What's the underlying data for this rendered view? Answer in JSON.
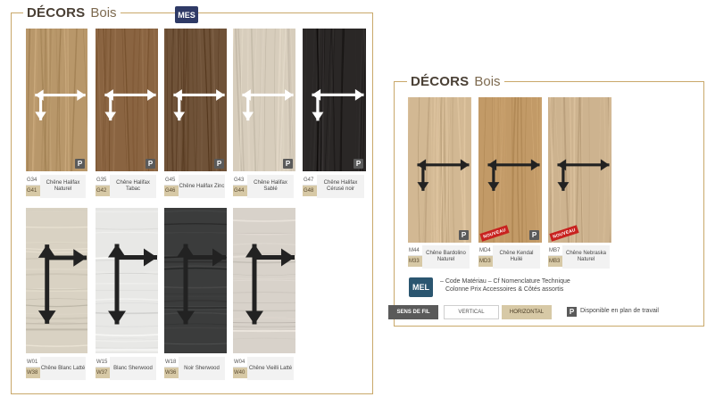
{
  "left_panel": {
    "title_main": "DÉCORS",
    "title_sub": "Bois",
    "badge": "MES",
    "swatches": [
      {
        "code_top": "G34",
        "code_bottom": "G41",
        "name": "Chêne Halifax Naturel",
        "p_badge": "P",
        "color": "#b8976a"
      },
      {
        "code_top": "G35",
        "code_bottom": "G42",
        "name": "Chêne Halifax Tabac",
        "p_badge": "P",
        "color": "#8a6441"
      },
      {
        "code_top": "G45",
        "code_bottom": "G46",
        "name": "Chêne Halifax Zinc",
        "p_badge": "P",
        "color": "#6f5238"
      },
      {
        "code_top": "G43",
        "code_bottom": "G44",
        "name": "Chêne Halifax Sablé",
        "p_badge": "P",
        "color": "#d7cdbc"
      },
      {
        "code_top": "G47",
        "code_bottom": "G48",
        "name": "Chêne Halifax Cérusé noir",
        "p_badge": "P",
        "color": "#2a2726"
      },
      {
        "code_top": "W01",
        "code_bottom": "W38",
        "name": "Chêne Blanc Latté",
        "p_badge": "",
        "color": "#d9d2c3"
      },
      {
        "code_top": "W15",
        "code_bottom": "W37",
        "name": "Blanc Sherwood",
        "p_badge": "",
        "color": "#e8e8e6"
      },
      {
        "code_top": "W18",
        "code_bottom": "W36",
        "name": "Noir Sherwood",
        "p_badge": "",
        "color": "#3b3c3c"
      },
      {
        "code_top": "W04",
        "code_bottom": "W40",
        "name": "Chêne Vieilli Latté",
        "p_badge": "",
        "color": "#d8d2ca"
      }
    ]
  },
  "right_panel": {
    "title_main": "DÉCORS",
    "title_sub": "Bois",
    "swatches": [
      {
        "code_top": "M44",
        "code_bottom": "M33",
        "name": "Chêne Bardolino Naturel",
        "p_badge": "P",
        "nouveau": "",
        "color": "#d2b893"
      },
      {
        "code_top": "MD4",
        "code_bottom": "MD3",
        "name": "Chêne Kendal Huilé",
        "p_badge": "P",
        "nouveau": "NOUVEAU",
        "color": "#c29a67"
      },
      {
        "code_top": "MB7",
        "code_bottom": "MB3",
        "name": "Chêne Nebraska Naturel",
        "p_badge": "",
        "nouveau": "NOUVEAU",
        "color": "#cdb38f"
      }
    ]
  },
  "legend": {
    "mel_badge": "MEL",
    "line1": "– Code Matériau – Cf Nomenclature Technique",
    "line2": "Colonne Prix Accessoires & Côtés assortis"
  },
  "grain_bar": {
    "label": "SENS DE FIL",
    "vertical": "VERTICAL",
    "horizontal": "HORIZONTAL",
    "p_badge": "P",
    "p_text": "Disponible en plan de travail"
  }
}
